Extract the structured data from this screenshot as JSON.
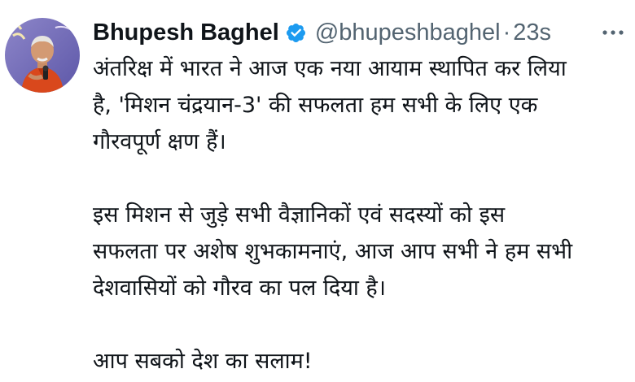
{
  "tweet": {
    "author_name": "Bhupesh Baghel",
    "handle": "@bhupeshbaghel",
    "separator": "·",
    "time": "23s",
    "more_icon": "ellipsis-icon",
    "verified_icon": "verified-badge-icon",
    "verified_color": "#1d9bf0",
    "paragraphs": [
      [
        "अंतरिक्ष में भारत ने आज एक नया आयाम स्थापित कर लिया",
        "है, 'मिशन चंद्रयान-3' की सफलता हम सभी के लिए एक",
        "गौरवपूर्ण क्षण हैं।"
      ],
      [
        "इस मिशन से जुड़े सभी वैज्ञानिकों एवं सदस्यों को इस",
        "सफलता पर अशेष शुभकामनाएं, आज आप सभी ने हम सभी",
        "देशवासियों को गौरव का पल दिया है।"
      ],
      [
        "आप सबको देश का सलाम!"
      ]
    ]
  }
}
